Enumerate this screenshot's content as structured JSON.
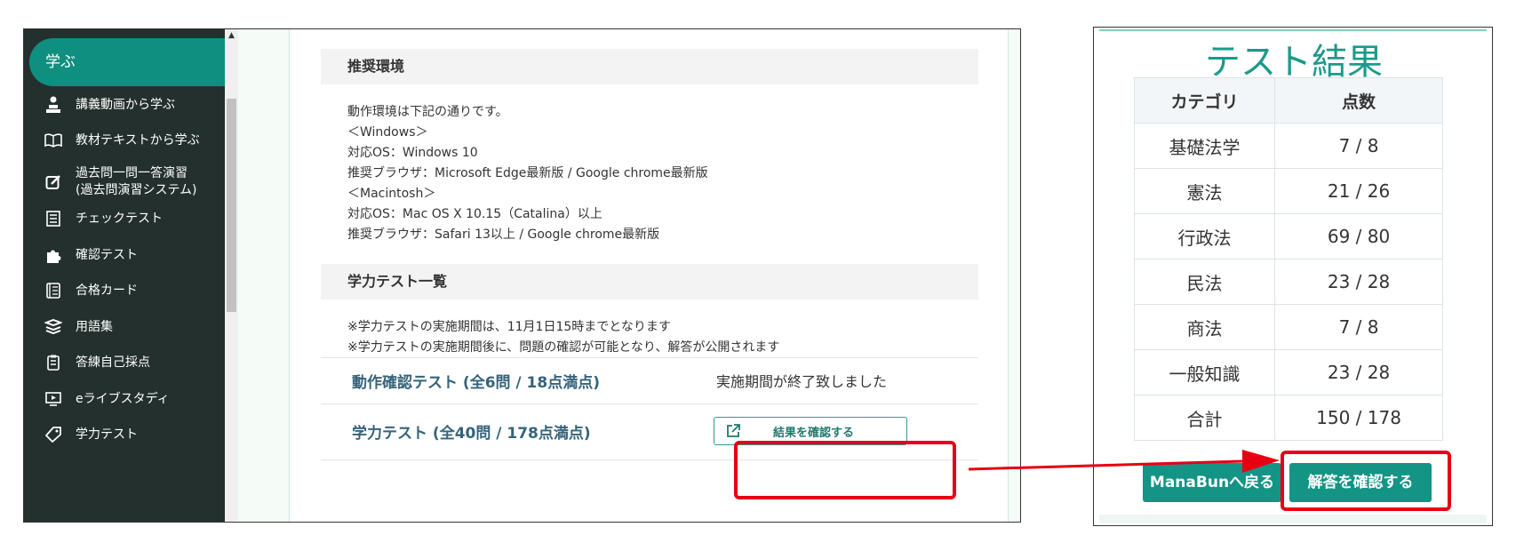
{
  "sidebar": {
    "active": "学ぶ",
    "items": [
      {
        "label": "講義動画から学ぶ",
        "icon": "lecturer-icon"
      },
      {
        "label": "教材テキストから学ぶ",
        "icon": "book-open-icon"
      },
      {
        "label": "過去問一問一答演習",
        "label2": "(過去問演習システム)",
        "icon": "edit-note-icon"
      },
      {
        "label": "チェックテスト",
        "icon": "checklist-icon"
      },
      {
        "label": "確認テスト",
        "icon": "puzzle-icon"
      },
      {
        "label": "合格カード",
        "icon": "card-icon"
      },
      {
        "label": "用語集",
        "icon": "stack-books-icon"
      },
      {
        "label": "答練自己採点",
        "icon": "clipboard-icon"
      },
      {
        "label": "eライブスタディ",
        "icon": "video-play-icon"
      },
      {
        "label": "学力テスト",
        "icon": "tag-icon"
      }
    ]
  },
  "content": {
    "env_heading": "推奨環境",
    "env_lines": [
      "動作環境は下記の通りです。",
      "＜Windows＞",
      "対応OS：Windows 10",
      "推奨ブラウザ：Microsoft Edge最新版 / Google chrome最新版",
      "＜Macintosh＞",
      "対応OS：Mac OS X 10.15（Catalina）以上",
      "推奨ブラウザ：Safari 13以上 / Google chrome最新版"
    ],
    "tests_heading": "学力テスト一覧",
    "notes": [
      "※学力テストの実施期間は、11月1日15時までとなります",
      "※学力テストの実施期間後に、問題の確認が可能となり、解答が公開されます"
    ],
    "tests": [
      {
        "title": "動作確認テスト (全6問 / 18点満点)",
        "status": "実施期間が終了致しました"
      },
      {
        "title": "学力テスト (全40問 / 178点満点)",
        "button": "結果を確認する"
      }
    ]
  },
  "results": {
    "title": "テスト結果",
    "headers": [
      "カテゴリ",
      "点数"
    ],
    "rows": [
      [
        "基礎法学",
        "7 / 8"
      ],
      [
        "憲法",
        "21 / 26"
      ],
      [
        "行政法",
        "69 / 80"
      ],
      [
        "民法",
        "23 / 28"
      ],
      [
        "商法",
        "7 / 8"
      ],
      [
        "一般知識",
        "23 / 28"
      ],
      [
        "合計",
        "150 / 178"
      ]
    ],
    "back_button": "ManaBunへ戻る",
    "answer_button": "解答を確認する"
  },
  "colors": {
    "accent": "#139485",
    "highlight": "#e60012",
    "sidebar": "#24302d"
  }
}
